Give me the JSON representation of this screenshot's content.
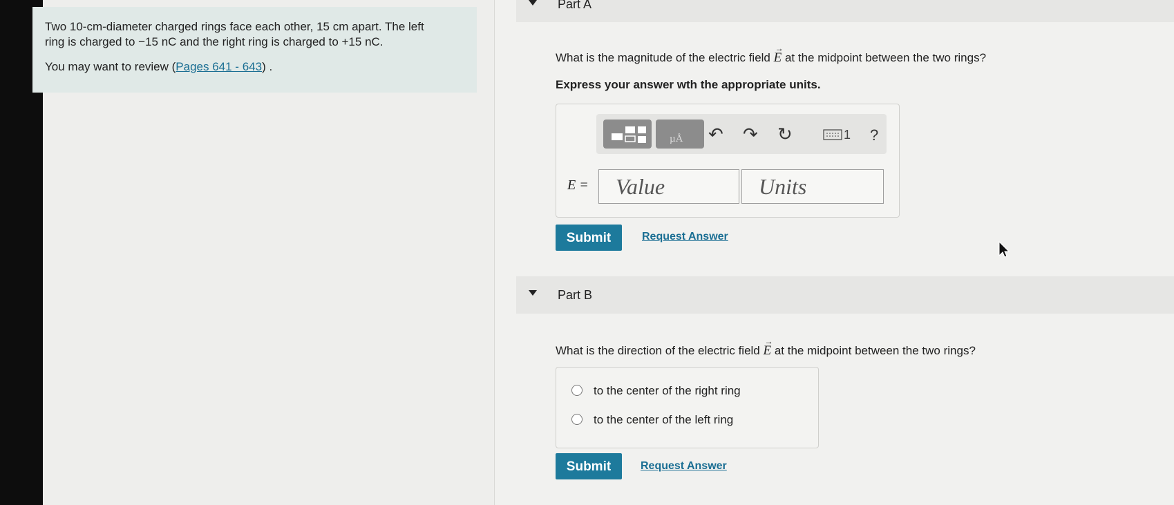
{
  "problem": {
    "text_line1": "Two 10-cm-diameter charged rings face each other, 15 cm apart. The left",
    "text_line2": "ring is charged to −15 nC and the right ring is charged to +15 nC.",
    "review_prefix": "You may want to review (",
    "review_link": "Pages 641 - 643",
    "review_suffix": ") ."
  },
  "partA": {
    "title": "Part A",
    "question_pre": "What is the magnitude of the electric field",
    "question_var": "E",
    "question_post": "at the midpoint between the two rings?",
    "instruction": "Express your answer wth the appropriate units.",
    "toolbar": {
      "icons": [
        "templates-icon",
        "units-icon",
        "undo-icon",
        "redo-icon",
        "reset-icon",
        "keyboard-icon",
        "help-icon"
      ],
      "units_label": "µÅ",
      "keyboard_label": "1",
      "help_label": "?"
    },
    "equation_label": "E =",
    "value_placeholder": "Value",
    "units_placeholder": "Units",
    "submit_label": "Submit",
    "request_label": "Request Answer"
  },
  "partB": {
    "title": "Part B",
    "question_pre": "What is the direction of the electric field",
    "question_var": "E",
    "question_post": "at the midpoint between the two rings?",
    "choices": [
      "to the center of the right ring",
      "to the center of the left ring"
    ],
    "submit_label": "Submit",
    "request_label": "Request Answer"
  },
  "colors": {
    "accent": "#1d7a9c",
    "link": "#1a6e93",
    "problem_bg": "#e0e9e7"
  }
}
